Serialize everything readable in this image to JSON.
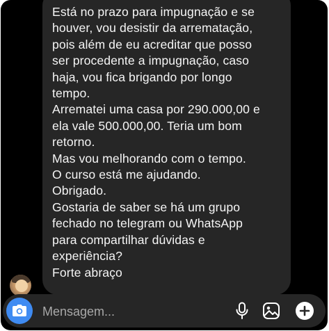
{
  "message": {
    "lines": [
      "Está no prazo para impugnação e se",
      "houver, vou desistir da arrematação,",
      "pois além de eu acreditar que posso",
      "ser procedente a impugnação, caso",
      "haja, vou fica brigando por longo",
      "tempo.",
      "Arrematei uma casa por 290.000,00 e",
      "ela vale 500.000,00. Teria um bom",
      "retorno.",
      "Mas vou melhorando com o tempo.",
      "O curso está me ajudando.",
      "Obrigado.",
      "Gostaria de saber se há um grupo",
      "fechado no telegram ou WhatsApp",
      "para compartilhar dúvidas e",
      "experiência?",
      "Forte abraço"
    ]
  },
  "composer": {
    "placeholder": "Mensagem..."
  },
  "icons": {
    "camera": "camera-icon",
    "mic": "microphone-icon",
    "gallery": "gallery-icon",
    "plus": "plus-icon"
  },
  "colors": {
    "background": "#000000",
    "bubble": "#262626",
    "text": "#f5f5f5",
    "placeholder": "#a8a8a8",
    "camera_accent": "#3f8bf2"
  }
}
